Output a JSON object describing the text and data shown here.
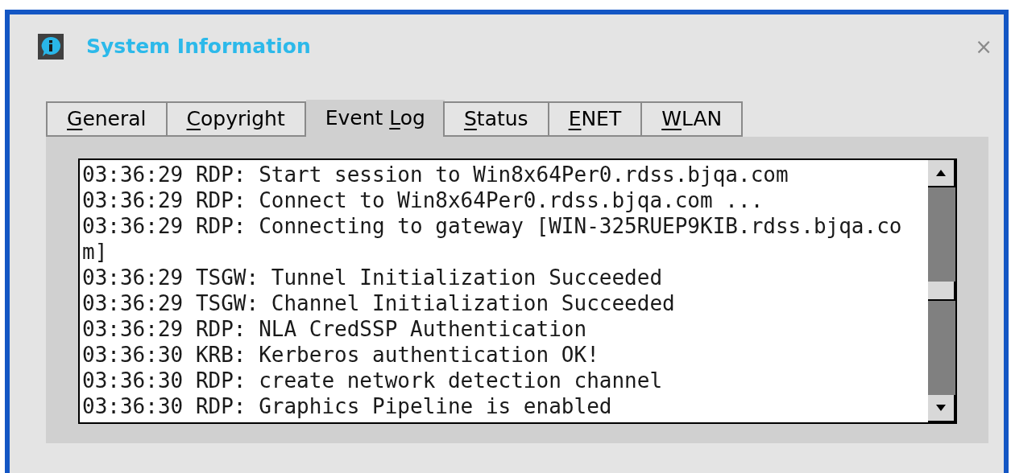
{
  "window": {
    "title": "System Information",
    "close": "×"
  },
  "tabs": [
    {
      "key": "G",
      "post": "eneral",
      "selected": false
    },
    {
      "key": "C",
      "post": "opyright",
      "selected": false
    },
    {
      "pre": "Event ",
      "key": "L",
      "post": "og",
      "selected": true
    },
    {
      "key": "S",
      "post": "tatus",
      "selected": false
    },
    {
      "key": "E",
      "post": "NET",
      "selected": false
    },
    {
      "key": "W",
      "post": "LAN",
      "selected": false
    }
  ],
  "event_log": [
    "03:36:29 RDP: Start session to Win8x64Per0.rdss.bjqa.com",
    "03:36:29 RDP: Connect to Win8x64Per0.rdss.bjqa.com ...",
    "03:36:29 RDP: Connecting to gateway [WIN-325RUEP9KIB.rdss.bjqa.com]",
    "03:36:29 TSGW: Tunnel Initialization Succeeded",
    "03:36:29 TSGW: Channel Initialization Succeeded",
    "03:36:29 RDP: NLA CredSSP Authentication",
    "03:36:30 KRB: Kerberos authentication OK!",
    "03:36:30 RDP: create network detection channel",
    "03:36:30 RDP: Graphics Pipeline is enabled"
  ]
}
